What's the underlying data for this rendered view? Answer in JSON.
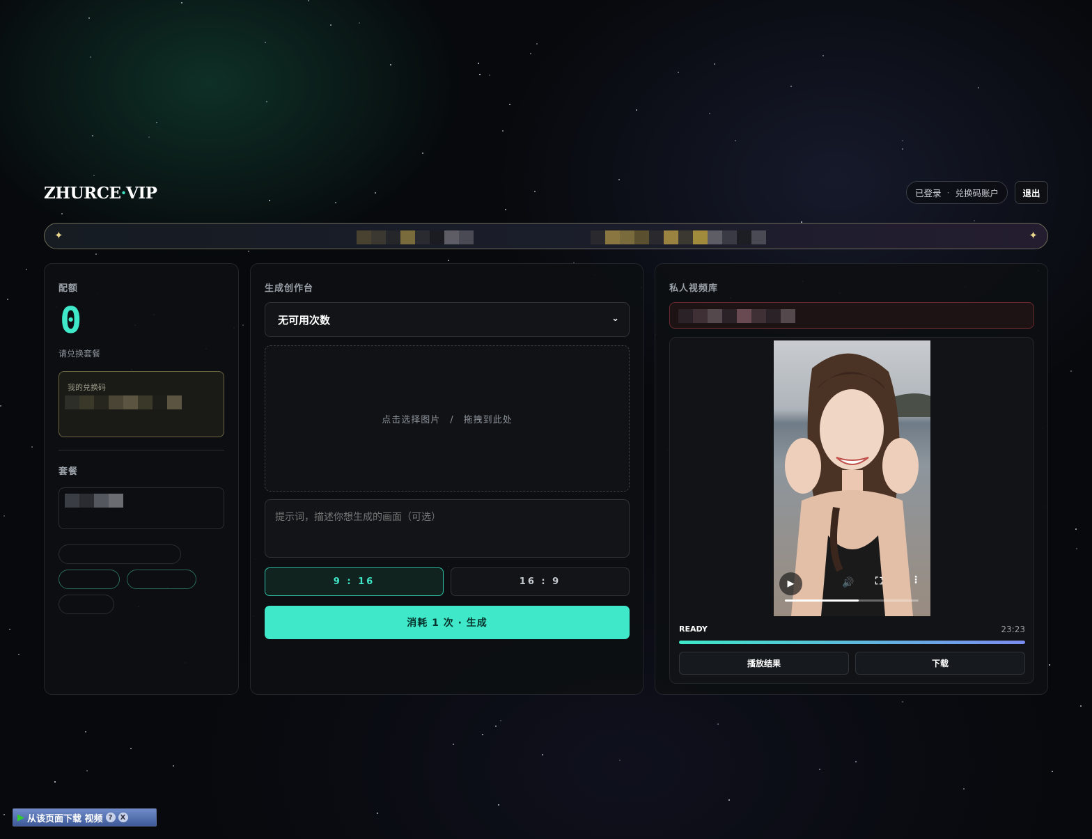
{
  "header": {
    "logo_main": "ZHURCE",
    "logo_dot": "·",
    "logo_suffix": "VIP",
    "status_logged": "已登录",
    "status_sep": "·",
    "status_account": "兑换码账户",
    "logout_label": "退出"
  },
  "banner": {
    "spark_icon": "✦"
  },
  "quota": {
    "title": "配额",
    "count": "0",
    "subtitle": "请兑换套餐",
    "code_label": "我的兑换码",
    "plans_title": "套餐"
  },
  "studio": {
    "title": "生成创作台",
    "select_value": "无可用次数",
    "dropzone_text": "点击选择图片　/　拖拽到此处",
    "prompt_placeholder": "提示词，描述你想生成的画面（可选）",
    "ratio_portrait": "9 : 16",
    "ratio_landscape": "16 : 9",
    "generate_label": "消耗 1 次 · 生成"
  },
  "library": {
    "title": "私人视频库",
    "status": "READY",
    "time": "23:23",
    "play_label": "播放结果",
    "download_label": "下载",
    "video_progress": 0.55,
    "task_progress": 1.0
  },
  "widget": {
    "label": "从该页面下载 视频",
    "help": "?",
    "close": "X"
  },
  "colors": {
    "accent": "#3ee8c8",
    "gradient_end": "#7b8cf0",
    "error_border": "#6a2a2e"
  }
}
